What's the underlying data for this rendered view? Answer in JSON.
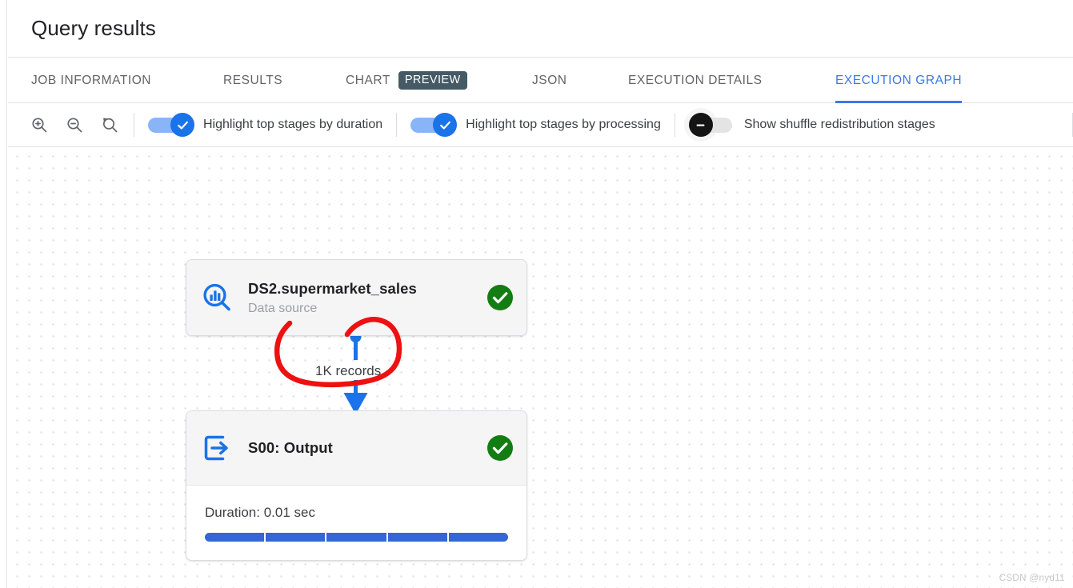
{
  "header": {
    "title": "Query results"
  },
  "tabs": [
    {
      "label": "JOB INFORMATION",
      "active": false,
      "badge": null
    },
    {
      "label": "RESULTS",
      "active": false,
      "badge": null
    },
    {
      "label": "CHART",
      "active": false,
      "badge": "PREVIEW"
    },
    {
      "label": "JSON",
      "active": false,
      "badge": null
    },
    {
      "label": "EXECUTION DETAILS",
      "active": false,
      "badge": null
    },
    {
      "label": "EXECUTION GRAPH",
      "active": true,
      "badge": null
    }
  ],
  "toolbar": {
    "zoom_in_icon": "zoom-in-icon",
    "zoom_out_icon": "zoom-out-icon",
    "zoom_reset_icon": "zoom-reset-icon",
    "toggles": [
      {
        "label": "Highlight top stages by duration",
        "state": "on"
      },
      {
        "label": "Highlight top stages by processing",
        "state": "on"
      },
      {
        "label": "Show shuffle redistribution stages",
        "state": "off"
      }
    ]
  },
  "graph": {
    "nodes": [
      {
        "title": "DS2.supermarket_sales",
        "subtitle": "Data source",
        "icon": "data-source-search-icon",
        "status": "success",
        "status_icon": "green-check-circle-icon"
      },
      {
        "title": "S00: Output",
        "subtitle": null,
        "icon": "output-arrow-icon",
        "status": "success",
        "status_icon": "green-check-circle-icon",
        "duration_label": "Duration: 0.01 sec",
        "progress_segments": 5
      }
    ],
    "edges": [
      {
        "label": "1K records",
        "from": "DS2.supermarket_sales",
        "to": "S00: Output"
      }
    ]
  },
  "annotation": {
    "shape": "hand-drawn-red-lasso",
    "color": "#ee1111"
  },
  "watermark": {
    "text": "CSDN @nyd11"
  },
  "colors": {
    "accent_blue": "#3b78e7",
    "node_icon_blue": "#1a73e8",
    "progress_blue": "#3367d6",
    "success_green": "#137d13",
    "badge_bg": "#455a64",
    "annotation_red": "#ee1111"
  }
}
